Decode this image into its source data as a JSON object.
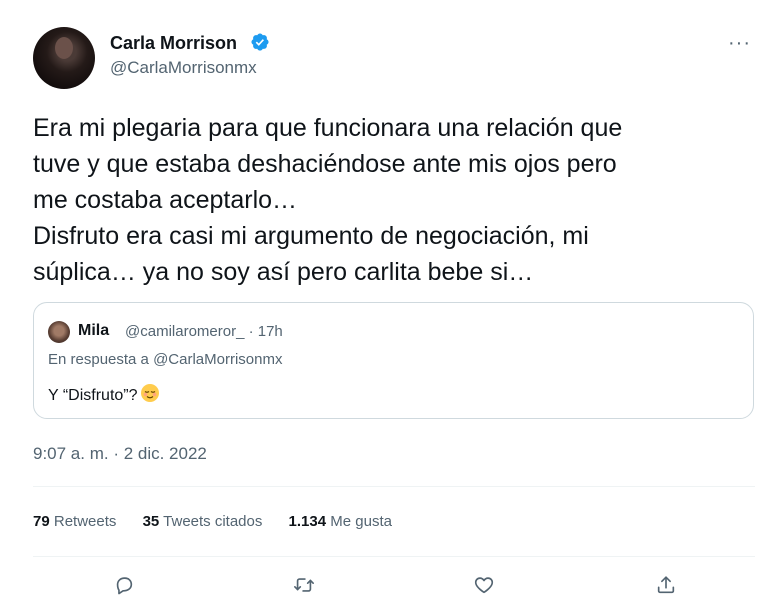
{
  "author": {
    "name": "Carla Morrison",
    "handle": "@CarlaMorrisonmx"
  },
  "menu": {
    "more_label": "···"
  },
  "tweet": {
    "lines": [
      "Era mi plegaria para que funcionara una relación que",
      "tuve y que estaba deshaciéndose ante mis ojos pero",
      "me costaba aceptarlo…",
      "Disfruto era casi mi argumento de negociación, mi",
      "súplica… ya no soy así pero carlita bebe si…"
    ]
  },
  "quote": {
    "name": "Mila",
    "handle_time": "@camilaromeror_ · 17h",
    "reply_prefix": "En respuesta a ",
    "reply_to": "@CarlaMorrisonmx",
    "text": "Y “Disfruto”?",
    "emoji": "relieved-face-emoji"
  },
  "timestamp": "9:07 a. m. · 2 dic. 2022",
  "stats": {
    "retweets_count": "79",
    "retweets_label": "Retweets",
    "quotes_count": "35",
    "quotes_label": "Tweets citados",
    "likes_count": "1.134",
    "likes_label": "Me gusta"
  },
  "actions": [
    "reply-icon",
    "retweet-icon",
    "like-icon",
    "share-icon"
  ],
  "colors": {
    "verified": "#1d9bf0",
    "secondary_text": "#536471",
    "border": "#cfd9de"
  }
}
